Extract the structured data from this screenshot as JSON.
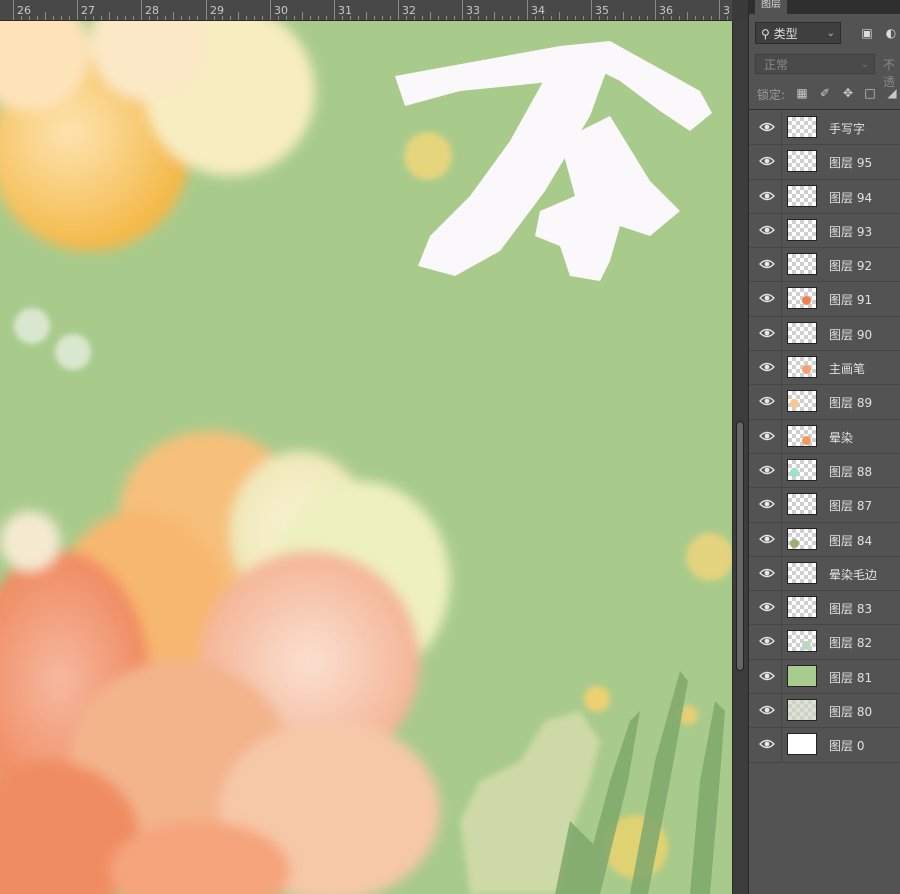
{
  "ruler": {
    "ticks": [
      "26",
      "27",
      "28",
      "29",
      "30",
      "31",
      "32",
      "33",
      "34",
      "35",
      "36",
      "3"
    ]
  },
  "panel": {
    "tab_title": "图层",
    "filter": {
      "label": "类型",
      "icon": "search-icon"
    },
    "blend_mode": "正常",
    "opacity_label": "不透",
    "lock_label": "锁定:",
    "layers": [
      {
        "name": "手写字",
        "thumb": "checker",
        "accent": ""
      },
      {
        "name": "图层 95",
        "thumb": "checker",
        "accent": ""
      },
      {
        "name": "图层 94",
        "thumb": "checker",
        "accent": ""
      },
      {
        "name": "图层 93",
        "thumb": "checker",
        "accent": ""
      },
      {
        "name": "图层 92",
        "thumb": "checker",
        "accent": ""
      },
      {
        "name": "图层 91",
        "thumb": "checker",
        "accent": "#f08050"
      },
      {
        "name": "图层 90",
        "thumb": "checker",
        "accent": ""
      },
      {
        "name": "主画笔",
        "thumb": "checker",
        "accent": "#f4a070"
      },
      {
        "name": "图层 89",
        "thumb": "checker",
        "accent": "#f7c890"
      },
      {
        "name": "晕染",
        "thumb": "checker",
        "accent": "#f29a5a"
      },
      {
        "name": "图层 88",
        "thumb": "checker",
        "accent": "#9fe0d0"
      },
      {
        "name": "图层 87",
        "thumb": "checker",
        "accent": ""
      },
      {
        "name": "图层 84",
        "thumb": "checker",
        "accent": "#9ab070"
      },
      {
        "name": "晕染毛边",
        "thumb": "checker",
        "accent": ""
      },
      {
        "name": "图层 83",
        "thumb": "checker",
        "accent": ""
      },
      {
        "name": "图层 82",
        "thumb": "checker",
        "accent": "#b8d8c0"
      },
      {
        "name": "图层 81",
        "thumb": "green",
        "accent": ""
      },
      {
        "name": "图层 80",
        "thumb": "green2",
        "accent": ""
      },
      {
        "name": "图层 0",
        "thumb": "white",
        "accent": ""
      }
    ]
  },
  "colors": {
    "canvas_bg": "#a8cb8c",
    "panel_bg": "#535353",
    "ui_dark": "#3a3a3a"
  }
}
